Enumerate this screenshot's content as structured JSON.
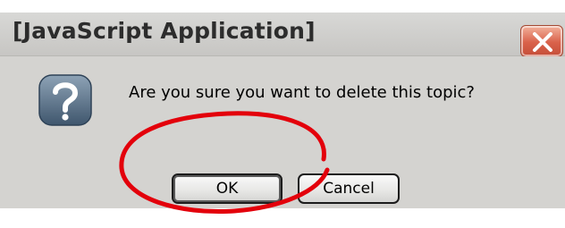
{
  "window": {
    "title": "[JavaScript Application]",
    "close_icon": "close-x-icon",
    "close_color": "#d9614a"
  },
  "dialog": {
    "icon": "question-mark-icon",
    "message": "Are you sure you want to delete this topic?",
    "ok_label": "OK",
    "cancel_label": "Cancel"
  },
  "annotation": {
    "shape": "ellipse",
    "color": "#e3000b"
  }
}
